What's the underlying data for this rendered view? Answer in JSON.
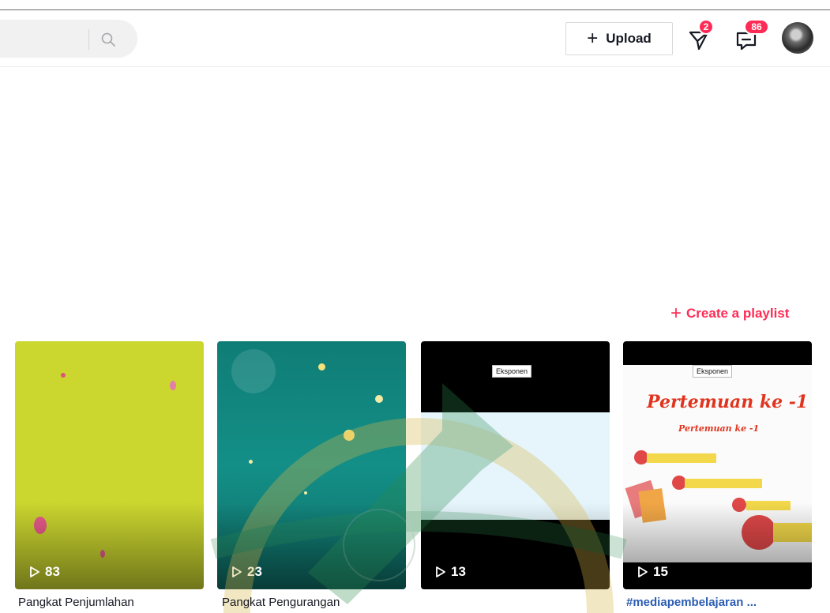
{
  "header": {
    "search_placeholder": "",
    "upload_label": "Upload",
    "inbox_badge": "2",
    "messages_badge": "86"
  },
  "profile": {
    "create_playlist_label": "Create a playlist"
  },
  "videos": [
    {
      "views": "83",
      "title": "Pangkat Penjumlahan",
      "color": "#cbd62f"
    },
    {
      "views": "23",
      "title": "Pangkat Pengurangan",
      "color": "#138f87"
    },
    {
      "views": "13",
      "title": "",
      "cover_label": "Eksponen",
      "color": "#000000"
    },
    {
      "views": "15",
      "title": "#mediapembelajaran ...",
      "cover_label": "Eksponen",
      "cover_heading": "Pertemuan ke -1",
      "cover_subheading": "Pertemuan ke -1",
      "color": "#000000"
    }
  ],
  "colors": {
    "accent": "#fe2c55",
    "hashtag": "#2b5db3"
  }
}
